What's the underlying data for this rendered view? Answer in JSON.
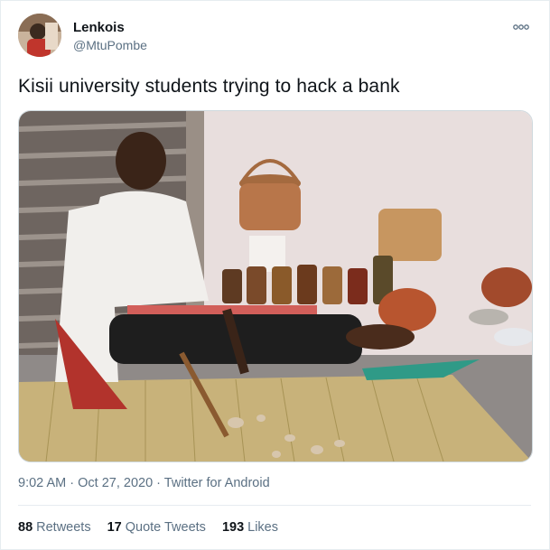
{
  "user": {
    "display_name": "Lenkois",
    "handle": "@MtuPombe"
  },
  "tweet": {
    "text": "Kisii university students trying to hack a bank",
    "time": "9:02 AM",
    "separator": "·",
    "date": "Oct 27, 2020",
    "source": "Twitter for Android"
  },
  "stats": [
    {
      "count": "88",
      "label": "Retweets"
    },
    {
      "count": "17",
      "label": "Quote Tweets"
    },
    {
      "count": "193",
      "label": "Likes"
    }
  ],
  "icons": {
    "more": "more-horizontal-icon"
  },
  "colors": {
    "text_primary": "#0f1419",
    "text_secondary": "#5b7083",
    "border": "#e6ecf0"
  }
}
